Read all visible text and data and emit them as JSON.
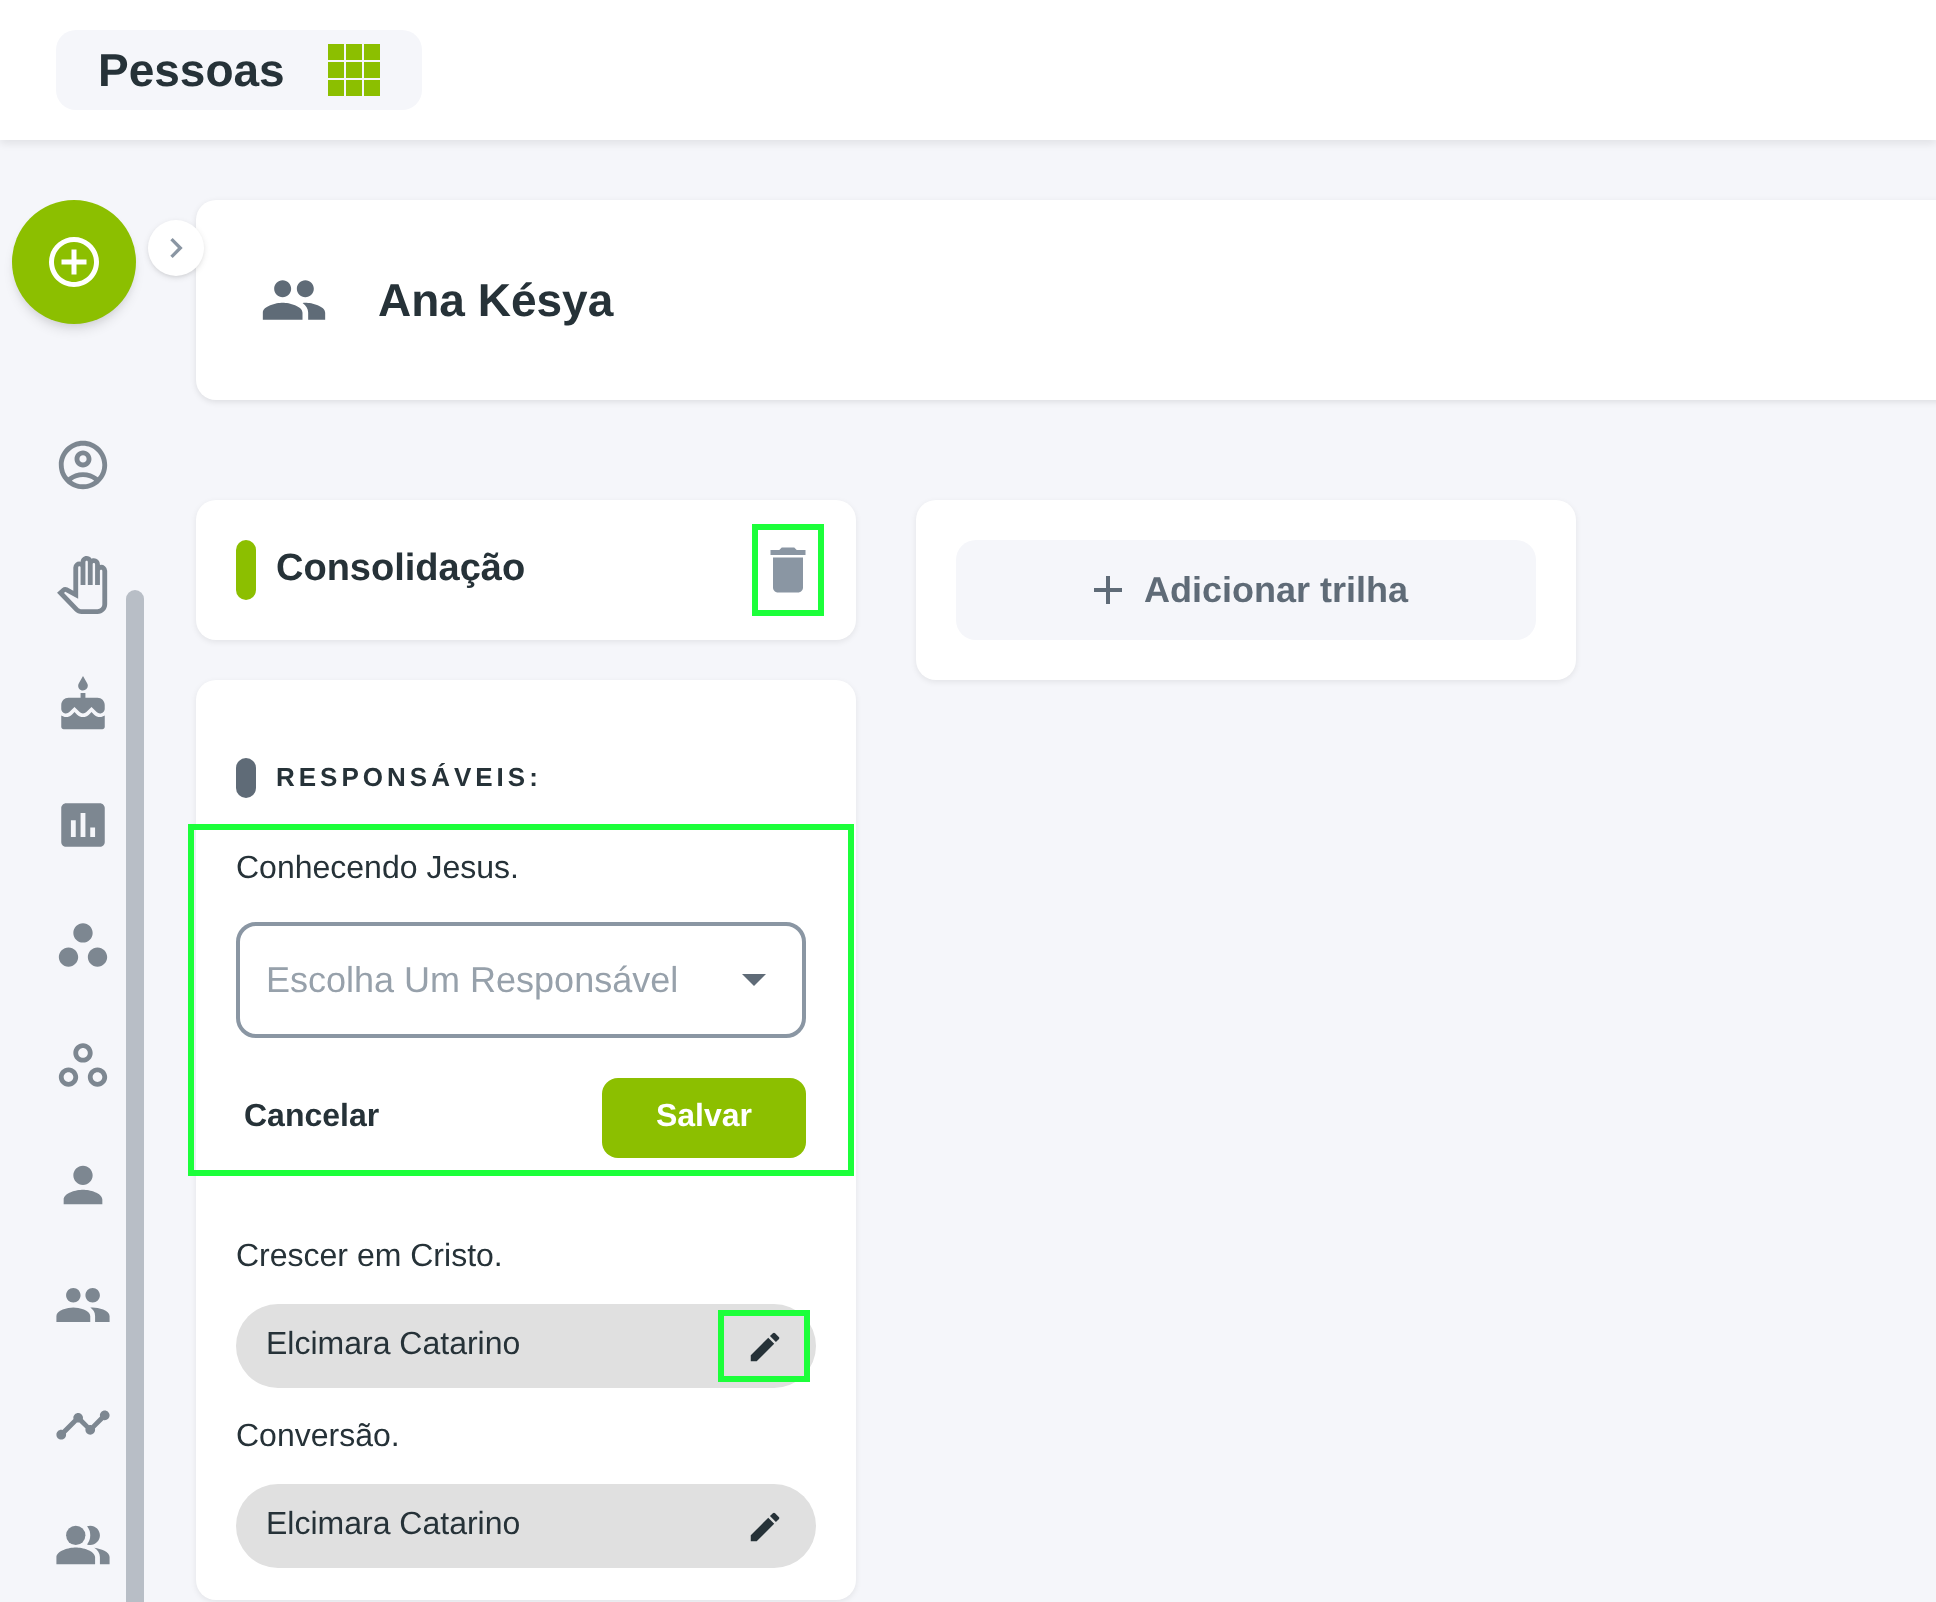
{
  "app": {
    "title": "Pessoas"
  },
  "person": {
    "name": "Ana Késya"
  },
  "track": {
    "title": "Consolidação",
    "delete_highlighted": true
  },
  "responsibles": {
    "heading": "RESPONSÁVEIS:",
    "edit_form": {
      "label": "Conhecendo Jesus.",
      "placeholder": "Escolha Um Responsável",
      "cancel": "Cancelar",
      "save": "Salvar",
      "highlighted": true
    },
    "items": [
      {
        "stage": "Crescer em Cristo.",
        "name": "Elcimara Catarino",
        "edit_highlighted": true
      },
      {
        "stage": "Conversão.",
        "name": "Elcimara Catarino",
        "edit_highlighted": false
      }
    ]
  },
  "add_track": {
    "label": "Adicionar trilha"
  }
}
